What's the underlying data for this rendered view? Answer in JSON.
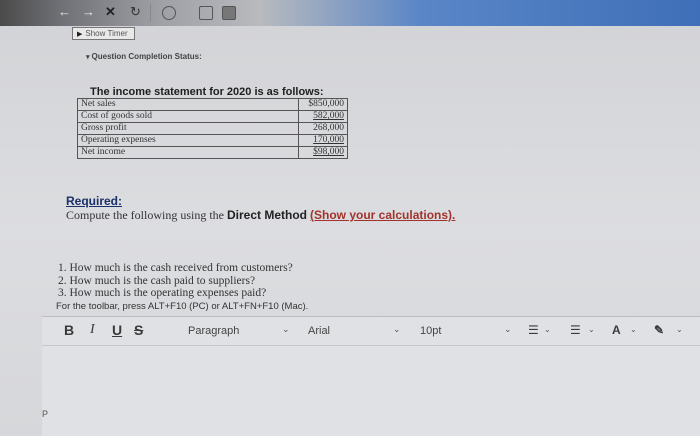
{
  "browser": {
    "back_icon": "←",
    "forward_icon": "→",
    "stop_icon": "✕",
    "reload_icon": "↻"
  },
  "timer": {
    "label": "Show Timer"
  },
  "status": {
    "label": "Question Completion Status:"
  },
  "statement": {
    "title": "The income statement for 2020 is as follows:",
    "rows": [
      {
        "label": "Net sales",
        "value": "$850,000"
      },
      {
        "label": "Cost of goods sold",
        "value": "582,000"
      },
      {
        "label": "Gross profit",
        "value": "268,000"
      },
      {
        "label": "Operating expenses",
        "value": "170,000"
      },
      {
        "label": "Net income",
        "value": "$98,000"
      }
    ]
  },
  "required": {
    "heading": "Required:",
    "instruction_prefix": "Compute the following using the ",
    "method": "Direct Method",
    "show_calc": "(Show your calculations)."
  },
  "questions": [
    "1. How much is the cash received from customers?",
    "2. How much is the cash paid to suppliers?",
    "3. How much is the operating expenses paid?"
  ],
  "toolbar_hint": "For the toolbar, press ALT+F10 (PC) or ALT+FN+F10 (Mac).",
  "editor": {
    "bold": "B",
    "italic": "I",
    "underline": "U",
    "strike": "S",
    "paragraph": "Paragraph",
    "font": "Arial",
    "size": "10pt",
    "dropdown_arrow": "⌄",
    "list_icon": "☰",
    "text_color_icon": "A",
    "highlight_icon": "✎",
    "path": "P"
  }
}
